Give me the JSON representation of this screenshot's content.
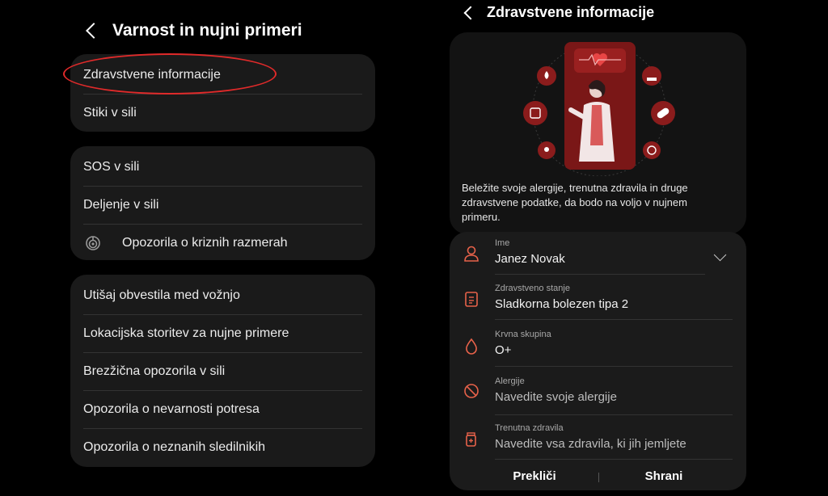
{
  "left": {
    "title": "Varnost in nujni primeri",
    "group1": [
      "Zdravstvene informacije",
      "Stiki v sili"
    ],
    "group2": [
      "SOS v sili",
      "Deljenje v sili",
      "Opozorila o kriznih razmerah"
    ],
    "group3": [
      "Utišaj obvestila med vožnjo",
      "Lokacijska storitev za nujne primere",
      "Brezžična opozorila v sili",
      "Opozorila o nevarnosti potresa",
      "Opozorila o neznanih sledilnikih"
    ],
    "highlight_color": "#e02a2a"
  },
  "right": {
    "title": "Zdravstvene informacije",
    "description": "Beležite svoje alergije, trenutna zdravila in druge zdravstvene podatke, da bodo na voljo v nujnem primeru.",
    "fields": [
      {
        "label": "Ime",
        "value": "Janez Novak",
        "icon": "person-icon"
      },
      {
        "label": "Zdravstveno stanje",
        "value": "Sladkorna bolezen tipa 2",
        "icon": "clipboard-icon"
      },
      {
        "label": "Krvna skupina",
        "value": "O+",
        "icon": "blood-drop-icon"
      },
      {
        "label": "Alergije",
        "placeholder": "Navedite svoje alergije",
        "icon": "no-entry-icon"
      },
      {
        "label": "Trenutna zdravila",
        "placeholder": "Navedite vsa zdravila, ki jih jemljete",
        "icon": "medicine-icon"
      }
    ],
    "cancel_label": "Prekliči",
    "save_label": "Shrani",
    "accent_color": "#e8624a"
  }
}
